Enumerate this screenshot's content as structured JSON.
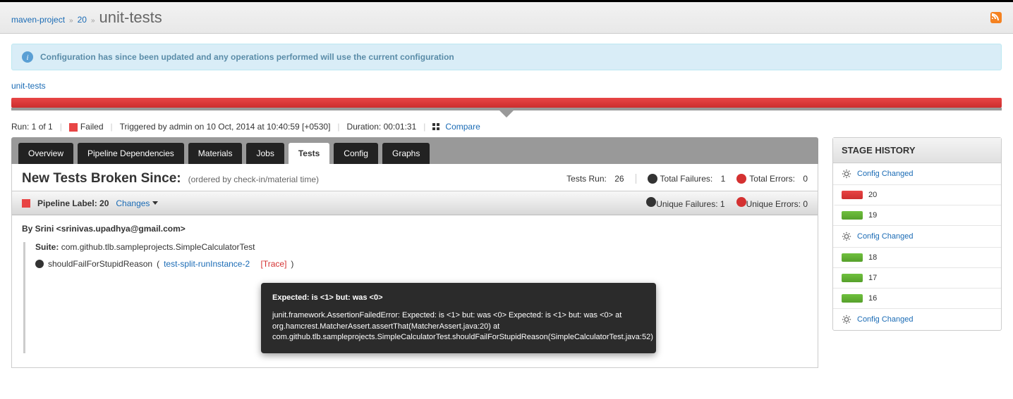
{
  "breadcrumb": {
    "pipeline": "maven-project",
    "build": "20",
    "stage": "unit-tests"
  },
  "banner": {
    "message": "Configuration has since been updated and any operations performed will use the current configuration"
  },
  "stage_link": "unit-tests",
  "meta": {
    "run": "Run: 1 of 1",
    "status": "Failed",
    "triggered": "Triggered by admin on 10 Oct, 2014 at 10:40:59 [+0530]",
    "duration": "Duration: 00:01:31",
    "compare": "Compare"
  },
  "tabs": [
    "Overview",
    "Pipeline Dependencies",
    "Materials",
    "Jobs",
    "Tests",
    "Config",
    "Graphs"
  ],
  "active_tab": "Tests",
  "summary": {
    "title": "New Tests Broken Since:",
    "subtitle": "(ordered by check-in/material time)",
    "tests_run_label": "Tests Run:",
    "tests_run": "26",
    "total_failures_label": "Total Failures:",
    "total_failures": "1",
    "total_errors_label": "Total Errors:",
    "total_errors": "0"
  },
  "pipeline_bar": {
    "label": "Pipeline Label: 20",
    "changes": "Changes",
    "unique_failures_label": "Unique Failures:",
    "unique_failures": "1",
    "unique_errors_label": "Unique Errors:",
    "unique_errors": "0"
  },
  "test_detail": {
    "by": "By Srini <srinivas.upadhya@gmail.com>",
    "suite_label": "Suite:",
    "suite_name": "com.github.tlb.sampleprojects.SimpleCalculatorTest",
    "test_name": "shouldFailForStupidReason",
    "instance_link": "test-split-runInstance-2",
    "trace_link": "[Trace]",
    "close_paren": ")",
    "open_paren": "(",
    "error_head": "Expected: is <1> but: was <0>",
    "error_body": "junit.framework.AssertionFailedError: Expected: is <1> but: was <0> Expected: is <1> but: was <0> at org.hamcrest.MatcherAssert.assertThat(MatcherAssert.java:20) at com.github.tlb.sampleprojects.SimpleCalculatorTest.shouldFailForStupidReason(SimpleCalculatorTest.java:52)"
  },
  "history": {
    "title": "STAGE HISTORY",
    "items": [
      {
        "type": "config",
        "label": "Config Changed"
      },
      {
        "type": "bar",
        "color": "red",
        "label": "20",
        "active": true
      },
      {
        "type": "bar",
        "color": "green",
        "label": "19"
      },
      {
        "type": "config",
        "label": "Config Changed"
      },
      {
        "type": "bar",
        "color": "green",
        "label": "18"
      },
      {
        "type": "bar",
        "color": "green",
        "label": "17"
      },
      {
        "type": "bar",
        "color": "green",
        "label": "16"
      },
      {
        "type": "config",
        "label": "Config Changed"
      }
    ]
  }
}
